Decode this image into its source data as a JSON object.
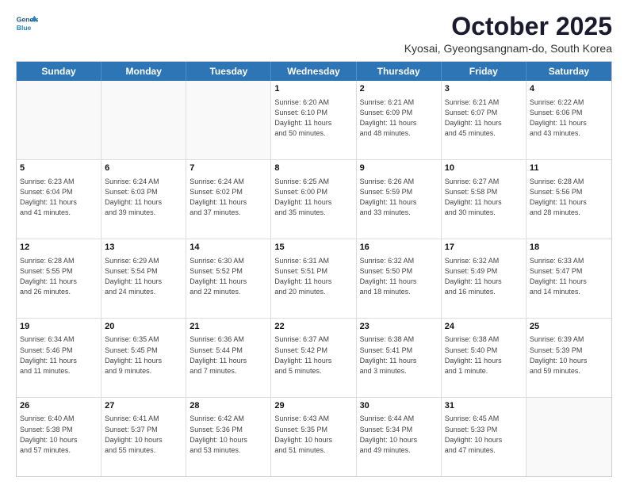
{
  "logo": {
    "line1": "General",
    "line2": "Blue"
  },
  "title": "October 2025",
  "subtitle": "Kyosai, Gyeongsangnam-do, South Korea",
  "days_of_week": [
    "Sunday",
    "Monday",
    "Tuesday",
    "Wednesday",
    "Thursday",
    "Friday",
    "Saturday"
  ],
  "weeks": [
    [
      {
        "day": "",
        "info": ""
      },
      {
        "day": "",
        "info": ""
      },
      {
        "day": "",
        "info": ""
      },
      {
        "day": "1",
        "info": "Sunrise: 6:20 AM\nSunset: 6:10 PM\nDaylight: 11 hours\nand 50 minutes."
      },
      {
        "day": "2",
        "info": "Sunrise: 6:21 AM\nSunset: 6:09 PM\nDaylight: 11 hours\nand 48 minutes."
      },
      {
        "day": "3",
        "info": "Sunrise: 6:21 AM\nSunset: 6:07 PM\nDaylight: 11 hours\nand 45 minutes."
      },
      {
        "day": "4",
        "info": "Sunrise: 6:22 AM\nSunset: 6:06 PM\nDaylight: 11 hours\nand 43 minutes."
      }
    ],
    [
      {
        "day": "5",
        "info": "Sunrise: 6:23 AM\nSunset: 6:04 PM\nDaylight: 11 hours\nand 41 minutes."
      },
      {
        "day": "6",
        "info": "Sunrise: 6:24 AM\nSunset: 6:03 PM\nDaylight: 11 hours\nand 39 minutes."
      },
      {
        "day": "7",
        "info": "Sunrise: 6:24 AM\nSunset: 6:02 PM\nDaylight: 11 hours\nand 37 minutes."
      },
      {
        "day": "8",
        "info": "Sunrise: 6:25 AM\nSunset: 6:00 PM\nDaylight: 11 hours\nand 35 minutes."
      },
      {
        "day": "9",
        "info": "Sunrise: 6:26 AM\nSunset: 5:59 PM\nDaylight: 11 hours\nand 33 minutes."
      },
      {
        "day": "10",
        "info": "Sunrise: 6:27 AM\nSunset: 5:58 PM\nDaylight: 11 hours\nand 30 minutes."
      },
      {
        "day": "11",
        "info": "Sunrise: 6:28 AM\nSunset: 5:56 PM\nDaylight: 11 hours\nand 28 minutes."
      }
    ],
    [
      {
        "day": "12",
        "info": "Sunrise: 6:28 AM\nSunset: 5:55 PM\nDaylight: 11 hours\nand 26 minutes."
      },
      {
        "day": "13",
        "info": "Sunrise: 6:29 AM\nSunset: 5:54 PM\nDaylight: 11 hours\nand 24 minutes."
      },
      {
        "day": "14",
        "info": "Sunrise: 6:30 AM\nSunset: 5:52 PM\nDaylight: 11 hours\nand 22 minutes."
      },
      {
        "day": "15",
        "info": "Sunrise: 6:31 AM\nSunset: 5:51 PM\nDaylight: 11 hours\nand 20 minutes."
      },
      {
        "day": "16",
        "info": "Sunrise: 6:32 AM\nSunset: 5:50 PM\nDaylight: 11 hours\nand 18 minutes."
      },
      {
        "day": "17",
        "info": "Sunrise: 6:32 AM\nSunset: 5:49 PM\nDaylight: 11 hours\nand 16 minutes."
      },
      {
        "day": "18",
        "info": "Sunrise: 6:33 AM\nSunset: 5:47 PM\nDaylight: 11 hours\nand 14 minutes."
      }
    ],
    [
      {
        "day": "19",
        "info": "Sunrise: 6:34 AM\nSunset: 5:46 PM\nDaylight: 11 hours\nand 11 minutes."
      },
      {
        "day": "20",
        "info": "Sunrise: 6:35 AM\nSunset: 5:45 PM\nDaylight: 11 hours\nand 9 minutes."
      },
      {
        "day": "21",
        "info": "Sunrise: 6:36 AM\nSunset: 5:44 PM\nDaylight: 11 hours\nand 7 minutes."
      },
      {
        "day": "22",
        "info": "Sunrise: 6:37 AM\nSunset: 5:42 PM\nDaylight: 11 hours\nand 5 minutes."
      },
      {
        "day": "23",
        "info": "Sunrise: 6:38 AM\nSunset: 5:41 PM\nDaylight: 11 hours\nand 3 minutes."
      },
      {
        "day": "24",
        "info": "Sunrise: 6:38 AM\nSunset: 5:40 PM\nDaylight: 11 hours\nand 1 minute."
      },
      {
        "day": "25",
        "info": "Sunrise: 6:39 AM\nSunset: 5:39 PM\nDaylight: 10 hours\nand 59 minutes."
      }
    ],
    [
      {
        "day": "26",
        "info": "Sunrise: 6:40 AM\nSunset: 5:38 PM\nDaylight: 10 hours\nand 57 minutes."
      },
      {
        "day": "27",
        "info": "Sunrise: 6:41 AM\nSunset: 5:37 PM\nDaylight: 10 hours\nand 55 minutes."
      },
      {
        "day": "28",
        "info": "Sunrise: 6:42 AM\nSunset: 5:36 PM\nDaylight: 10 hours\nand 53 minutes."
      },
      {
        "day": "29",
        "info": "Sunrise: 6:43 AM\nSunset: 5:35 PM\nDaylight: 10 hours\nand 51 minutes."
      },
      {
        "day": "30",
        "info": "Sunrise: 6:44 AM\nSunset: 5:34 PM\nDaylight: 10 hours\nand 49 minutes."
      },
      {
        "day": "31",
        "info": "Sunrise: 6:45 AM\nSunset: 5:33 PM\nDaylight: 10 hours\nand 47 minutes."
      },
      {
        "day": "",
        "info": ""
      }
    ]
  ]
}
